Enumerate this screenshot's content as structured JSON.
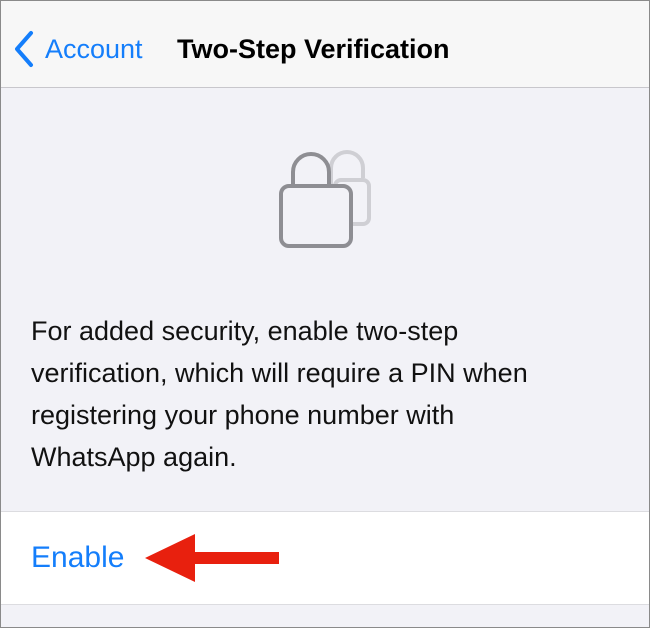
{
  "navbar": {
    "back_label": "Account",
    "title": "Two-Step Verification"
  },
  "main": {
    "illustration_icon": "lock-icon",
    "description": "For added security, enable two-step\nverification, which will require a PIN when\nregistering your phone number with\nWhatsApp again."
  },
  "enable_row": {
    "enable_label": "Enable",
    "annotation_icon": "red-arrow-icon"
  },
  "colors": {
    "accent": "#147efb",
    "annotation": "#e8200e",
    "background": "#f2f2f7"
  }
}
